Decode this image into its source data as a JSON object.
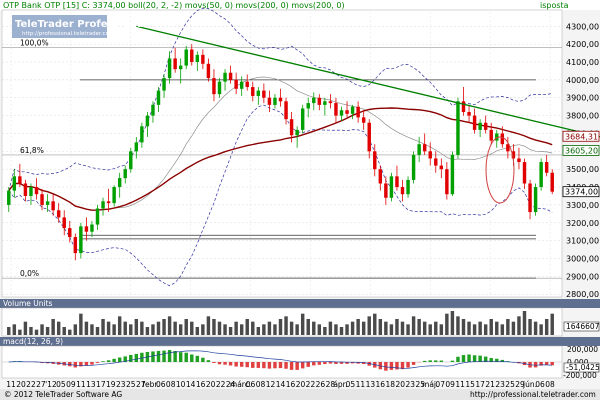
{
  "header": {
    "info": "OTP Bank OTP [15] C: 3374,00 boll(20, 2, -2) movs(50, 0) movs(200, 0) movs(200, 0)",
    "corner_label": "isposta"
  },
  "logo": {
    "title": "TeleTrader Professional",
    "url": "http://professional.teletrader.com"
  },
  "fib_labels": [
    "100,0%",
    "61,8%",
    "0,0%"
  ],
  "price_tags": [
    {
      "value": "3684,31",
      "color": "#8b0000"
    },
    {
      "value": "3605,20",
      "color": "#006400"
    },
    {
      "value": "3374,00",
      "color": "#000000"
    }
  ],
  "volume_panel": {
    "title": "Volume Units",
    "value_label": "1646607"
  },
  "macd_panel": {
    "title": "macd(12, 26, 9)",
    "value_label": "-51,0425",
    "ticks": [
      "200,000",
      "0,000",
      "-200,000"
    ]
  },
  "footer": {
    "copyright": "© 2012 TeleTrader Software AG",
    "url": "http://professional.teletrader.com"
  },
  "chart_data": {
    "type": "candlestick",
    "title": "OTP Bank OTP",
    "y_ticks": [
      "4300,00",
      "4200,00",
      "4100,00",
      "4000,00",
      "3900,00",
      "3800,00",
      "3700,00",
      "3600,00",
      "3500,00",
      "3400,00",
      "3300,00",
      "3200,00",
      "3100,00",
      "3000,00",
      "2900,00",
      "2800,00"
    ],
    "ylim": [
      2790,
      4380
    ],
    "x_labels": [
      "11",
      "20",
      "22",
      "27",
      "'12",
      "05",
      "09",
      "11",
      "13",
      "17",
      "19",
      "23",
      "25",
      "27",
      "febr.",
      "06",
      "08",
      "10",
      "14",
      "16",
      "20",
      "22",
      "24",
      "márc.",
      "06",
      "08",
      "12",
      "14",
      "16",
      "20",
      "22",
      "26",
      "28",
      "ápr.",
      "05",
      "11",
      "13",
      "16",
      "18",
      "20",
      "23",
      "25",
      "máj.",
      "07",
      "09",
      "11",
      "15",
      "17",
      "21",
      "23",
      "25",
      "29",
      "jún.",
      "06",
      "08"
    ],
    "fib_levels": [
      {
        "label": "100,0%",
        "value": 4180
      },
      {
        "label": "61,8%",
        "value": 3580
      },
      {
        "label": "0,0%",
        "value": 2890
      }
    ],
    "horizontal_levels": [
      4000,
      3130,
      3110,
      2890
    ],
    "trendline": {
      "from": [
        23,
        4300
      ],
      "to": [
        119,
        3590
      ]
    },
    "candles": [
      [
        3300,
        3400,
        3260,
        3380
      ],
      [
        3380,
        3500,
        3340,
        3460
      ],
      [
        3460,
        3530,
        3400,
        3420
      ],
      [
        3420,
        3440,
        3320,
        3350
      ],
      [
        3350,
        3420,
        3300,
        3400
      ],
      [
        3400,
        3450,
        3330,
        3360
      ],
      [
        3360,
        3390,
        3270,
        3300
      ],
      [
        3300,
        3360,
        3260,
        3320
      ],
      [
        3320,
        3360,
        3240,
        3270
      ],
      [
        3270,
        3310,
        3200,
        3230
      ],
      [
        3230,
        3270,
        3130,
        3170
      ],
      [
        3170,
        3210,
        3090,
        3120
      ],
      [
        3120,
        3140,
        2990,
        3030
      ],
      [
        3030,
        3200,
        3000,
        3180
      ],
      [
        3180,
        3230,
        3100,
        3150
      ],
      [
        3150,
        3210,
        3120,
        3190
      ],
      [
        3190,
        3300,
        3160,
        3280
      ],
      [
        3280,
        3340,
        3240,
        3320
      ],
      [
        3320,
        3390,
        3260,
        3310
      ],
      [
        3310,
        3410,
        3290,
        3400
      ],
      [
        3400,
        3480,
        3340,
        3450
      ],
      [
        3450,
        3520,
        3420,
        3500
      ],
      [
        3500,
        3620,
        3480,
        3600
      ],
      [
        3600,
        3680,
        3560,
        3650
      ],
      [
        3650,
        3760,
        3620,
        3740
      ],
      [
        3740,
        3820,
        3680,
        3800
      ],
      [
        3800,
        3880,
        3760,
        3860
      ],
      [
        3860,
        3960,
        3820,
        3940
      ],
      [
        3940,
        4030,
        3900,
        4010
      ],
      [
        4010,
        4160,
        3980,
        4120
      ],
      [
        4120,
        4180,
        4040,
        4060
      ],
      [
        4060,
        4120,
        3980,
        4080
      ],
      [
        4080,
        4190,
        4060,
        4170
      ],
      [
        4170,
        4200,
        4080,
        4100
      ],
      [
        4100,
        4160,
        4050,
        4140
      ],
      [
        4140,
        4170,
        4060,
        4090
      ],
      [
        4090,
        4120,
        3990,
        4010
      ],
      [
        4010,
        4060,
        3880,
        3920
      ],
      [
        3920,
        4010,
        3900,
        3990
      ],
      [
        3990,
        4060,
        3940,
        4040
      ],
      [
        4040,
        4080,
        3980,
        4000
      ],
      [
        4000,
        4040,
        3920,
        3950
      ],
      [
        3950,
        4020,
        3910,
        3990
      ],
      [
        3990,
        4030,
        3940,
        3960
      ],
      [
        3960,
        3990,
        3880,
        3910
      ],
      [
        3910,
        3960,
        3860,
        3940
      ],
      [
        3940,
        3980,
        3870,
        3900
      ],
      [
        3900,
        3940,
        3820,
        3860
      ],
      [
        3860,
        3920,
        3840,
        3900
      ],
      [
        3900,
        3950,
        3850,
        3880
      ],
      [
        3880,
        3900,
        3750,
        3780
      ],
      [
        3780,
        3820,
        3650,
        3690
      ],
      [
        3690,
        3740,
        3620,
        3720
      ],
      [
        3720,
        3860,
        3700,
        3840
      ],
      [
        3840,
        3900,
        3790,
        3870
      ],
      [
        3870,
        3930,
        3830,
        3900
      ],
      [
        3900,
        3920,
        3830,
        3860
      ],
      [
        3860,
        3900,
        3800,
        3880
      ],
      [
        3880,
        3920,
        3840,
        3870
      ],
      [
        3870,
        3900,
        3760,
        3800
      ],
      [
        3800,
        3850,
        3770,
        3830
      ],
      [
        3830,
        3880,
        3790,
        3810
      ],
      [
        3810,
        3860,
        3780,
        3850
      ],
      [
        3850,
        3880,
        3760,
        3790
      ],
      [
        3790,
        3830,
        3720,
        3760
      ],
      [
        3760,
        3780,
        3560,
        3600
      ],
      [
        3600,
        3640,
        3460,
        3500
      ],
      [
        3500,
        3520,
        3380,
        3420
      ],
      [
        3420,
        3460,
        3300,
        3340
      ],
      [
        3340,
        3480,
        3320,
        3460
      ],
      [
        3460,
        3520,
        3380,
        3400
      ],
      [
        3400,
        3440,
        3320,
        3360
      ],
      [
        3360,
        3460,
        3340,
        3440
      ],
      [
        3440,
        3600,
        3420,
        3580
      ],
      [
        3580,
        3680,
        3540,
        3640
      ],
      [
        3640,
        3700,
        3580,
        3600
      ],
      [
        3600,
        3650,
        3520,
        3560
      ],
      [
        3560,
        3600,
        3480,
        3520
      ],
      [
        3520,
        3560,
        3450,
        3500
      ],
      [
        3500,
        3540,
        3330,
        3360
      ],
      [
        3360,
        3600,
        3350,
        3580
      ],
      [
        3580,
        3900,
        3560,
        3880
      ],
      [
        3880,
        3960,
        3800,
        3820
      ],
      [
        3820,
        3860,
        3760,
        3800
      ],
      [
        3800,
        3840,
        3700,
        3720
      ],
      [
        3720,
        3780,
        3680,
        3760
      ],
      [
        3760,
        3800,
        3700,
        3720
      ],
      [
        3720,
        3760,
        3640,
        3660
      ],
      [
        3660,
        3720,
        3620,
        3700
      ],
      [
        3700,
        3740,
        3620,
        3640
      ],
      [
        3640,
        3680,
        3560,
        3600
      ],
      [
        3600,
        3640,
        3520,
        3560
      ],
      [
        3560,
        3620,
        3500,
        3540
      ],
      [
        3540,
        3560,
        3390,
        3420
      ],
      [
        3420,
        3440,
        3220,
        3260
      ],
      [
        3260,
        3420,
        3240,
        3400
      ],
      [
        3400,
        3560,
        3380,
        3540
      ],
      [
        3540,
        3580,
        3460,
        3480
      ],
      [
        3480,
        3500,
        3360,
        3374
      ]
    ],
    "volume": [
      3,
      4,
      2,
      5,
      3,
      2,
      4,
      3,
      6,
      5,
      3,
      2,
      4,
      8,
      5,
      4,
      3,
      6,
      5,
      4,
      7,
      5,
      4,
      6,
      5,
      3,
      4,
      5,
      6,
      7,
      5,
      4,
      6,
      5,
      3,
      4,
      7,
      6,
      5,
      4,
      3,
      5,
      4,
      6,
      5,
      3,
      4,
      5,
      4,
      6,
      7,
      5,
      4,
      8,
      6,
      5,
      4,
      3,
      5,
      4,
      3,
      4,
      5,
      6,
      5,
      7,
      8,
      6,
      5,
      4,
      6,
      5,
      4,
      7,
      6,
      5,
      4,
      5,
      4,
      8,
      9,
      7,
      6,
      5,
      4,
      5,
      4,
      6,
      5,
      4,
      6,
      5,
      7,
      9,
      6,
      5,
      4,
      6,
      8
    ]
  }
}
